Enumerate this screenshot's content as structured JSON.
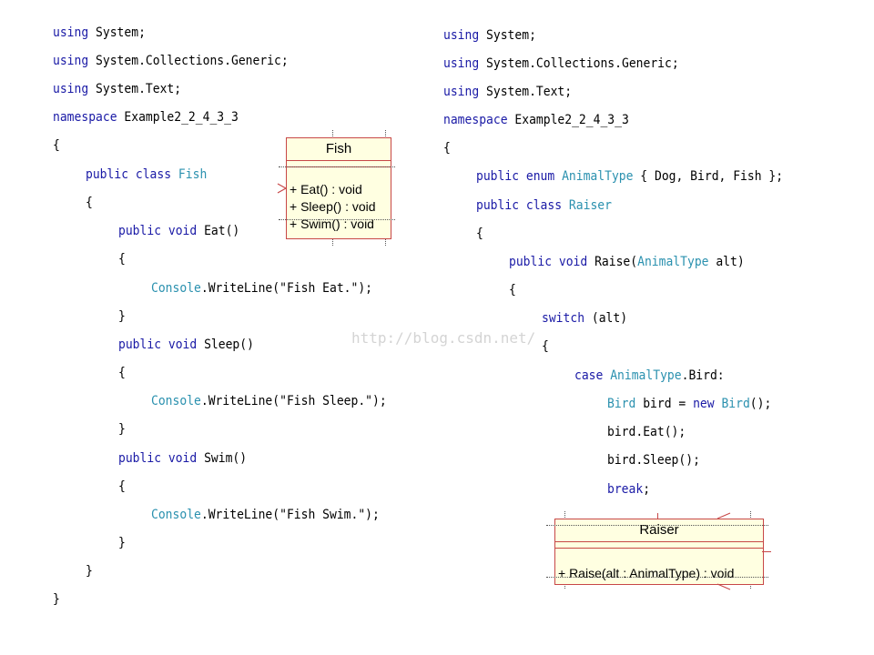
{
  "left_code": {
    "l1": [
      "using",
      " System;"
    ],
    "l2": [
      "using",
      " System.Collections.Generic;"
    ],
    "l3": [
      "using",
      " System.Text;"
    ],
    "l4": [
      "namespace",
      " Example2_2_4_3_3"
    ],
    "l5": "{",
    "l6": [
      "public class",
      " ",
      "Fish"
    ],
    "l7": "{",
    "l8": [
      "public void",
      " Eat()"
    ],
    "l9": "{",
    "l10": [
      "Console",
      ".WriteLine(\"Fish Eat.\");"
    ],
    "l11": "}",
    "l12": [
      "public void",
      " Sleep()"
    ],
    "l13": "{",
    "l14": [
      "Console",
      ".WriteLine(\"Fish Sleep.\");"
    ],
    "l15": "}",
    "l16": [
      "public void",
      " Swim()"
    ],
    "l17": "{",
    "l18": [
      "Console",
      ".WriteLine(\"Fish Swim.\");"
    ],
    "l19": "}",
    "l20": "}",
    "l21": "}"
  },
  "right_code": {
    "r1": [
      "using",
      " System;"
    ],
    "r2": [
      "using",
      " System.Collections.Generic;"
    ],
    "r3": [
      "using",
      " System.Text;"
    ],
    "r4": [
      "namespace",
      " Example2_2_4_3_3"
    ],
    "r5": "{",
    "r6": [
      "public enum",
      " ",
      "AnimalType",
      " { Dog, Bird, Fish };"
    ],
    "r7": [
      "public class",
      " ",
      "Raiser"
    ],
    "r8": "{",
    "r9": [
      "public void",
      " Raise(",
      "AnimalType",
      " alt)"
    ],
    "r10": "{",
    "r11": [
      "switch",
      " (alt)"
    ],
    "r12": "{",
    "r13": [
      "case",
      " ",
      "AnimalType",
      ".Bird:"
    ],
    "r14": [
      "Bird",
      " bird = ",
      "new",
      " ",
      "Bird",
      "();"
    ],
    "r15": "bird.Eat();",
    "r16": "bird.Sleep();",
    "r17": [
      "break",
      ";"
    ]
  },
  "fish_uml": {
    "title": "Fish",
    "ops": [
      "+ Eat() : void",
      "+ Sleep() : void",
      "+ Swim() : void"
    ]
  },
  "raiser_uml": {
    "title": "Raiser",
    "ops": [
      "+ Raise(alt : AnimalType) : void"
    ]
  },
  "watermark": "http://blog.csdn.net/",
  "colors": {
    "keyword": "#1a1aa6",
    "type": "#2b91af",
    "uml_border": "#c74747",
    "uml_fill": "#ffffe1"
  }
}
